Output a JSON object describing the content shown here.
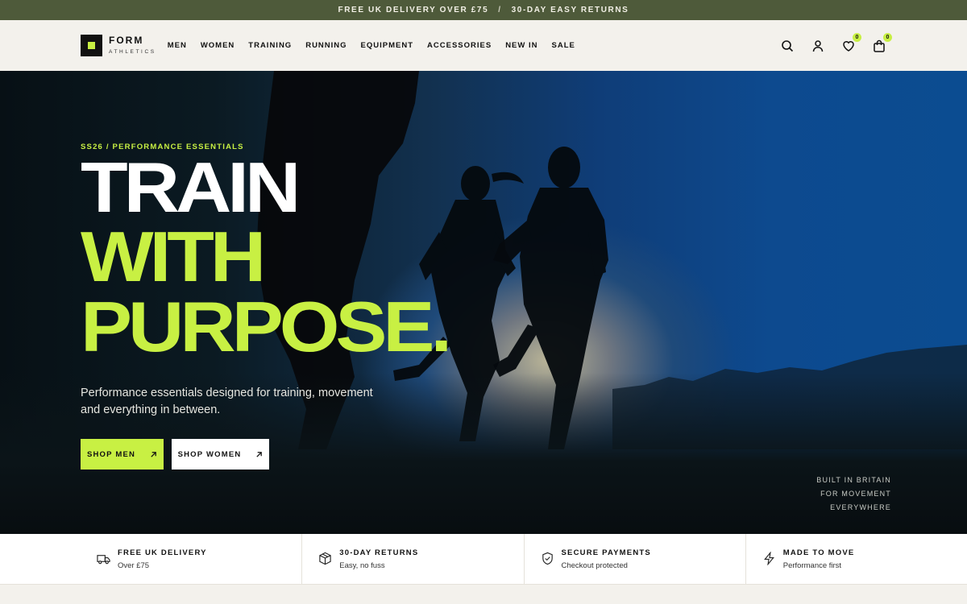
{
  "announcement": {
    "left": "FREE UK DELIVERY OVER £75",
    "separator": "/",
    "right": "30-DAY EASY RETURNS"
  },
  "brand": {
    "name": "FORM",
    "sub": "ATHLETICS",
    "accent": "#c8f043"
  },
  "nav": {
    "items": [
      "MEN",
      "WOMEN",
      "TRAINING",
      "RUNNING",
      "EQUIPMENT",
      "ACCESSORIES",
      "NEW IN",
      "SALE"
    ]
  },
  "header_icons": {
    "search": "search-icon",
    "account": "user-icon",
    "wishlist": "heart-icon",
    "wishlist_count": "0",
    "cart": "bag-icon",
    "cart_count": "0"
  },
  "hero": {
    "eyebrow": "SS26 / PERFORMANCE ESSENTIALS",
    "headline_1": "TRAIN",
    "headline_2": "WITH",
    "headline_3": "PURPOSE.",
    "subtext": "Performance essentials designed for training, movement and everything in between.",
    "cta_men": "SHOP MEN",
    "cta_women": "SHOP WOMEN",
    "tagline": [
      "BUILT IN BRITAIN",
      "FOR MOVEMENT",
      "EVERYWHERE"
    ]
  },
  "features": [
    {
      "icon": "truck-icon",
      "title": "FREE UK DELIVERY",
      "sub": "Over £75"
    },
    {
      "icon": "box-icon",
      "title": "30-DAY RETURNS",
      "sub": "Easy, no fuss"
    },
    {
      "icon": "shield-icon",
      "title": "SECURE PAYMENTS",
      "sub": "Checkout protected"
    },
    {
      "icon": "bolt-icon",
      "title": "MADE TO MOVE",
      "sub": "Performance first"
    }
  ]
}
